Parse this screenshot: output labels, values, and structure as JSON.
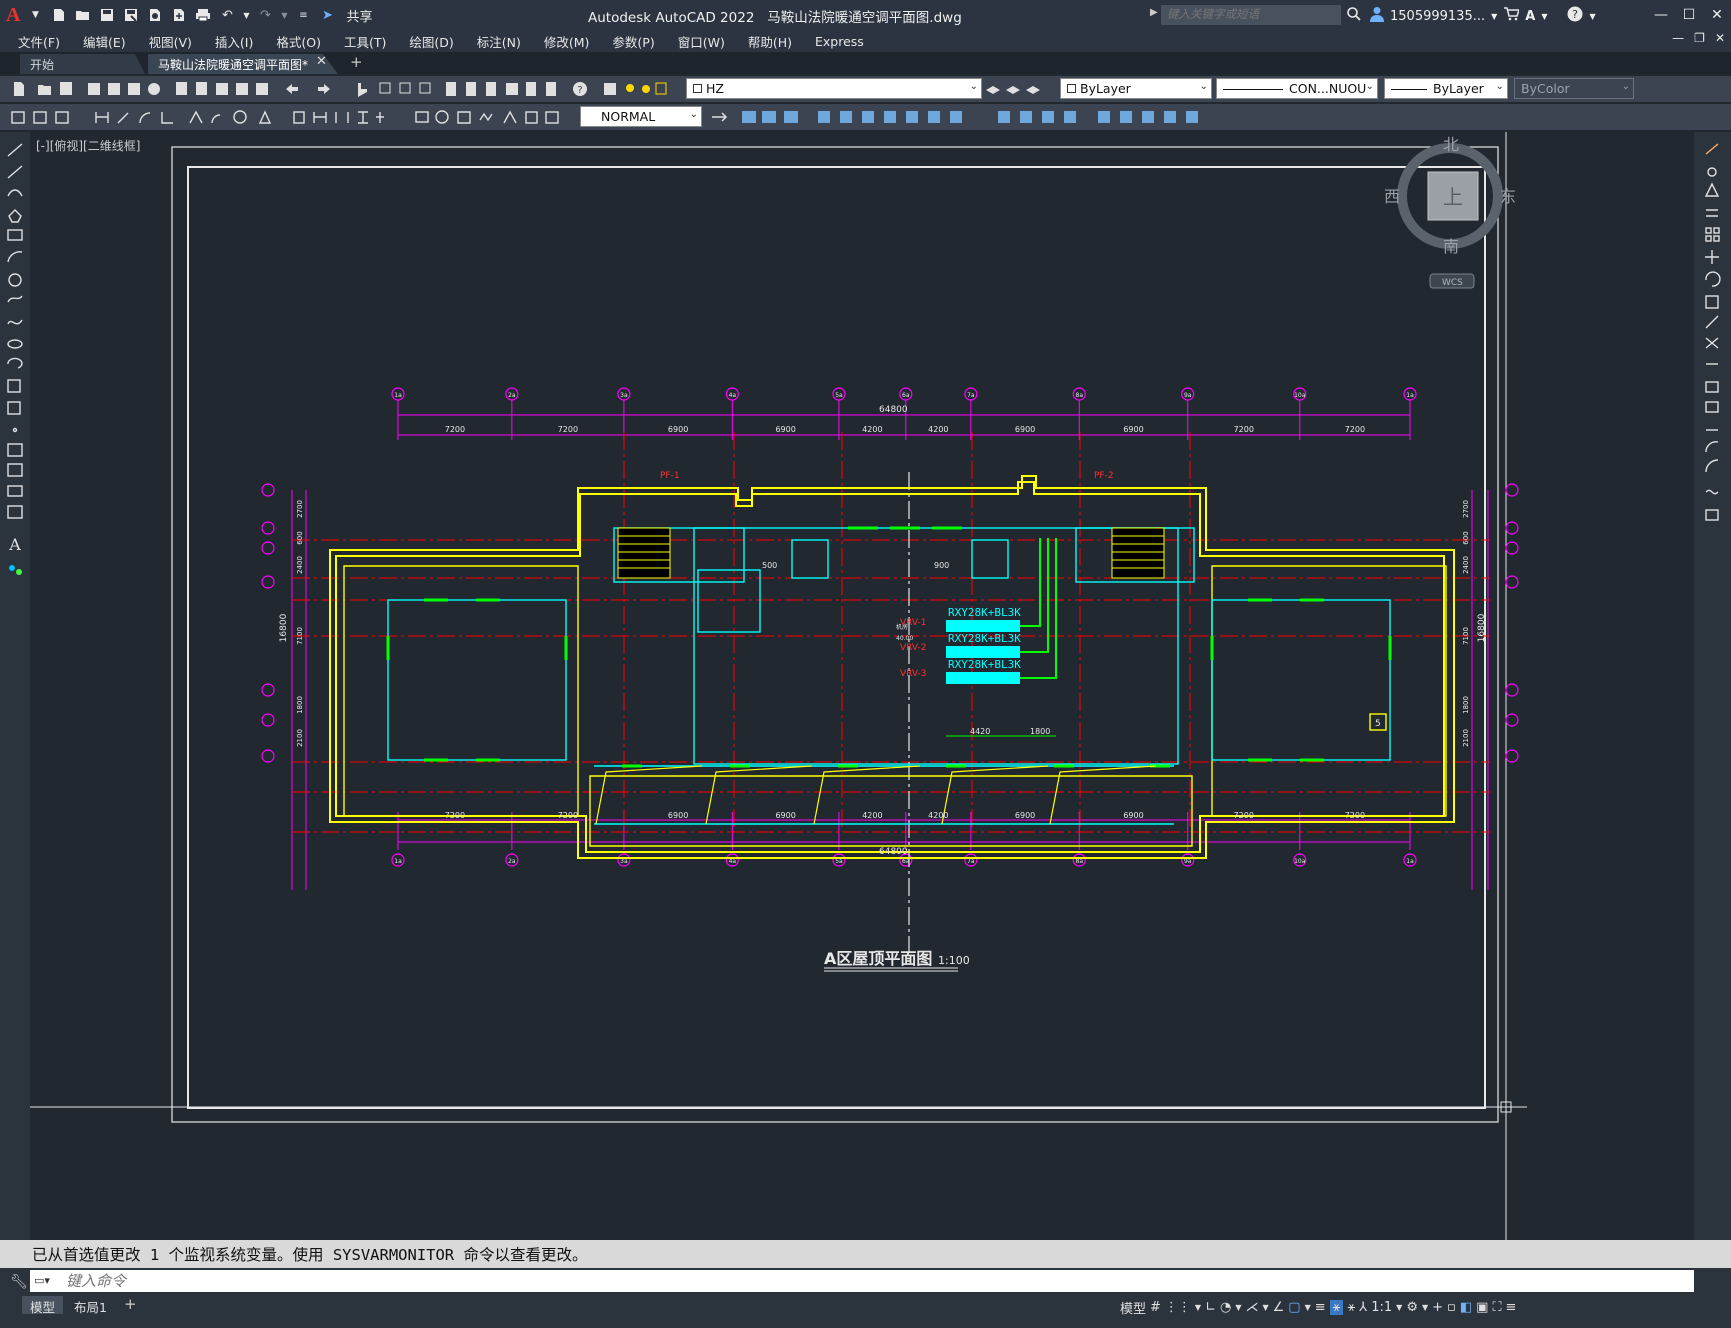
{
  "app": {
    "name": "Autodesk AutoCAD 2022",
    "file": "马鞍山法院暖通空调平面图.dwg",
    "share_label": "共享",
    "search_placeholder": "键入关键字或短语",
    "user": "1505999135...",
    "logo_letter": "A"
  },
  "menu": [
    "文件(F)",
    "编辑(E)",
    "视图(V)",
    "插入(I)",
    "格式(O)",
    "工具(T)",
    "绘图(D)",
    "标注(N)",
    "修改(M)",
    "参数(P)",
    "窗口(W)",
    "帮助(H)",
    "Express"
  ],
  "tabs": {
    "start": "开始",
    "drawing": "马鞍山法院暖通空调平面图*"
  },
  "toolbar": {
    "layer": "HZ",
    "color": "ByLayer",
    "linetype": "CON...NUOU",
    "lineweight": "ByLayer",
    "plotstyle": "ByColor",
    "text_style": "NORMAL"
  },
  "viewport_label": "[-][俯视][二维线框]",
  "viewcube": {
    "north": "北",
    "south": "南",
    "east": "东",
    "west": "西",
    "top": "上",
    "wcs": "WCS"
  },
  "drawing": {
    "title": "A区屋顶平面图",
    "scale": "1:100",
    "overall_dim": "64800",
    "top_dims": [
      "7200",
      "7200",
      "6900",
      "6900",
      "4200",
      "4200",
      "6900",
      "6900",
      "7200",
      "7200"
    ],
    "bottom_dims": [
      "7200",
      "7200",
      "6900",
      "6900",
      "4200",
      "4200",
      "6900",
      "6900",
      "7200",
      "7200"
    ],
    "left_dims": [
      "2700",
      "600",
      "2400",
      "7100",
      "1800",
      "2100"
    ],
    "left_total": "16800",
    "right_dims": [
      "2700",
      "600",
      "2400",
      "7100",
      "1800",
      "2100"
    ],
    "right_total": "16800",
    "units": [
      "RXY28K+BL3K",
      "RXY28K+BL3K",
      "RXY28K+BL3K"
    ],
    "inner_dims": [
      "4420",
      "1800",
      "500",
      "900"
    ],
    "red_labels": [
      "VRV-1",
      "VRV-2",
      "VRV-3",
      "PF-1",
      "PF-2"
    ],
    "grid_labels": [
      "1a",
      "2a",
      "3a",
      "4a",
      "5a",
      "6a",
      "7a",
      "8a",
      "9a",
      "10a"
    ],
    "box_label": "5"
  },
  "command": {
    "history": "已从首选值更改 1 个监视系统变量。使用 SYSVARMONITOR 命令以查看更改。",
    "placeholder": "键入命令"
  },
  "status": {
    "model_tab": "模型",
    "layout_tab": "布局1",
    "model_label": "模型",
    "scale": "1:1"
  },
  "colors": {
    "yellow": "#ffff00",
    "cyan": "#00ffff",
    "magenta": "#ff00ff",
    "red": "#ff0000",
    "green": "#00ff00",
    "canvas": "#212830"
  }
}
